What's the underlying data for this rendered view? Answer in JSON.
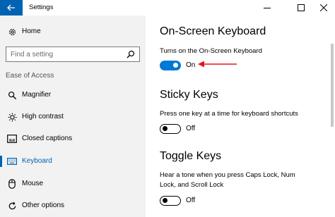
{
  "window": {
    "title": "Settings",
    "controls": [
      "minimize-icon",
      "maximize-icon",
      "close-icon"
    ],
    "accent_color": "#0063b1"
  },
  "sidebar": {
    "home_label": "Home",
    "search_placeholder": "Find a setting",
    "section_label": "Ease of Access",
    "items": [
      {
        "label": "Magnifier",
        "icon": "magnifier-icon",
        "selected": false
      },
      {
        "label": "High contrast",
        "icon": "brightness-icon",
        "selected": false
      },
      {
        "label": "Closed captions",
        "icon": "closed-captions-icon",
        "selected": false
      },
      {
        "label": "Keyboard",
        "icon": "keyboard-icon",
        "selected": true
      },
      {
        "label": "Mouse",
        "icon": "mouse-icon",
        "selected": false
      },
      {
        "label": "Other options",
        "icon": "refresh-icon",
        "selected": false
      }
    ]
  },
  "main": {
    "sections": [
      {
        "heading": "On-Screen Keyboard",
        "description": "Turns on the On-Screen Keyboard",
        "toggle_state": "On",
        "toggle_on": true
      },
      {
        "heading": "Sticky Keys",
        "description": "Press one key at a time for keyboard shortcuts",
        "toggle_state": "Off",
        "toggle_on": false
      },
      {
        "heading": "Toggle Keys",
        "description": "Hear a tone when you press Caps Lock, Num Lock, and Scroll Lock",
        "toggle_state": "Off",
        "toggle_on": false
      }
    ],
    "annotation_arrow_color": "#e0161b",
    "toggle_on_color": "#0078d7"
  }
}
